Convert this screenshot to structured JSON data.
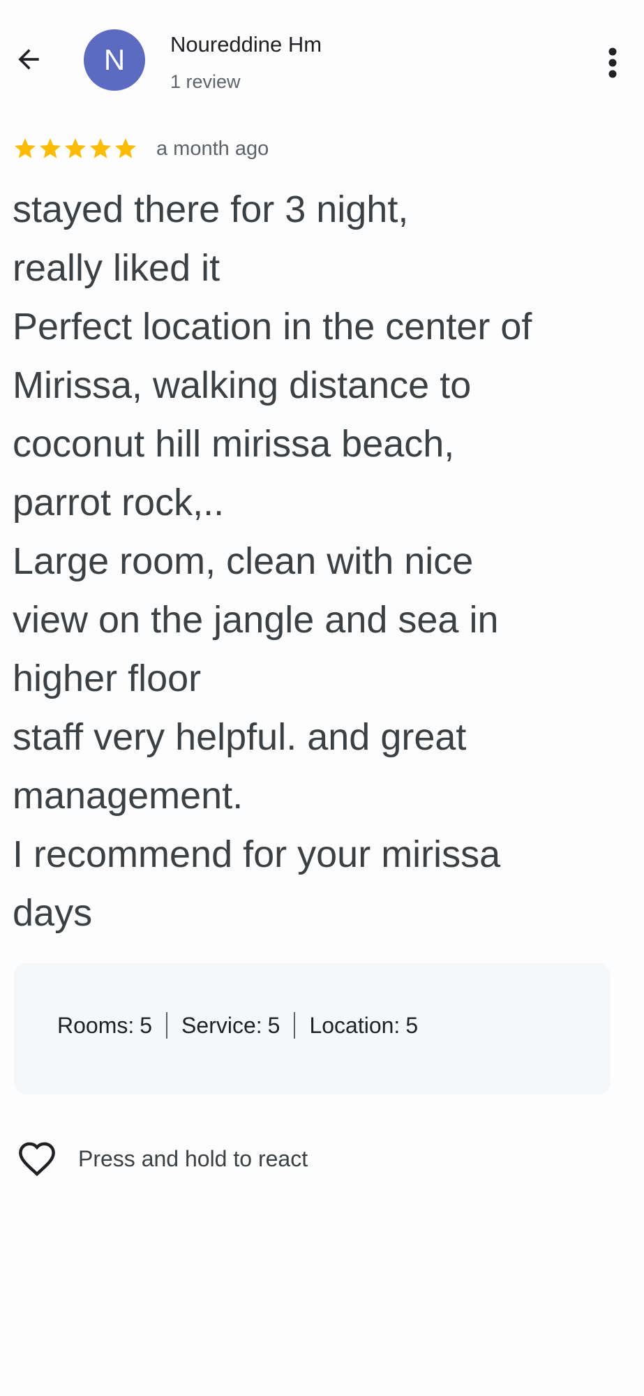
{
  "header": {
    "back_icon": "arrow-back-icon",
    "avatar_initial": "N",
    "avatar_color": "#5c6bc0",
    "author_name": "Noureddine Hm",
    "author_meta": "1 review",
    "more_icon": "more-vert-icon"
  },
  "review": {
    "star_rating": 5,
    "star_max": 5,
    "star_color": "#fbbc04",
    "date": "a month ago",
    "lines": [
      "stayed there for 3 night,",
      "really liked it",
      "Perfect location in the center of",
      "Mirissa, walking distance to",
      "coconut hill mirissa beach,",
      "parrot rock,..",
      "Large room, clean with nice",
      "view on the jangle and sea in",
      "higher floor",
      "staff very helpful. and great",
      "management.",
      "I recommend for your mirissa",
      "days"
    ]
  },
  "ratings": [
    {
      "label": "Rooms:",
      "value": "5"
    },
    {
      "label": "Service:",
      "value": "5"
    },
    {
      "label": "Location:",
      "value": "5"
    }
  ],
  "reaction": {
    "icon": "heart-outline-icon",
    "label": "Press and hold to react"
  }
}
